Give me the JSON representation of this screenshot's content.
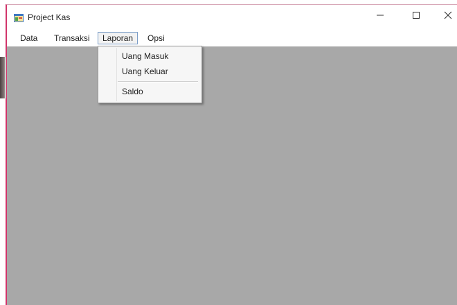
{
  "window": {
    "title": "Project Kas",
    "icon": "app-window-icon",
    "controls": {
      "minimize": "—",
      "maximize": "☐",
      "close": "✕"
    }
  },
  "menubar": {
    "items": [
      {
        "label": "Data"
      },
      {
        "label": "Transaksi"
      },
      {
        "label": "Laporan",
        "open": true
      },
      {
        "label": "Opsi"
      }
    ]
  },
  "dropdown": {
    "parent": "Laporan",
    "items": [
      {
        "label": "Uang Masuk"
      },
      {
        "label": "Uang Keluar"
      },
      {
        "label": "Saldo"
      }
    ]
  },
  "colors": {
    "client_background": "#a8a8a8",
    "window_border": "#d1346a",
    "menu_highlight_border": "#7a9cc7"
  }
}
